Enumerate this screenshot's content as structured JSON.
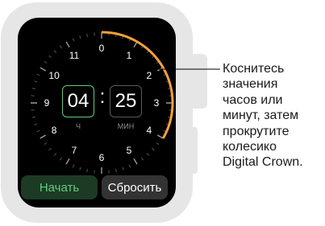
{
  "timer": {
    "dial_numbers": [
      "0",
      "1",
      "2",
      "3",
      "4",
      "5",
      "6",
      "7",
      "8",
      "9",
      "10",
      "11"
    ],
    "hours_value": "04",
    "minutes_value": "25",
    "separator": ":",
    "hours_unit": "Ч",
    "minutes_unit": "МИН",
    "start_label": "Начать",
    "reset_label": "Сбросить"
  },
  "callout": {
    "lines": [
      "Коснитесь",
      "значения",
      "часов или",
      "минут, затем",
      "прокрутите",
      "колесико",
      "Digital Crown."
    ]
  },
  "colors": {
    "progress_arc": "#f5a03a",
    "accent_green": "#5fcd7c",
    "screen_bg": "#000000",
    "case": "#e6e6e6"
  }
}
